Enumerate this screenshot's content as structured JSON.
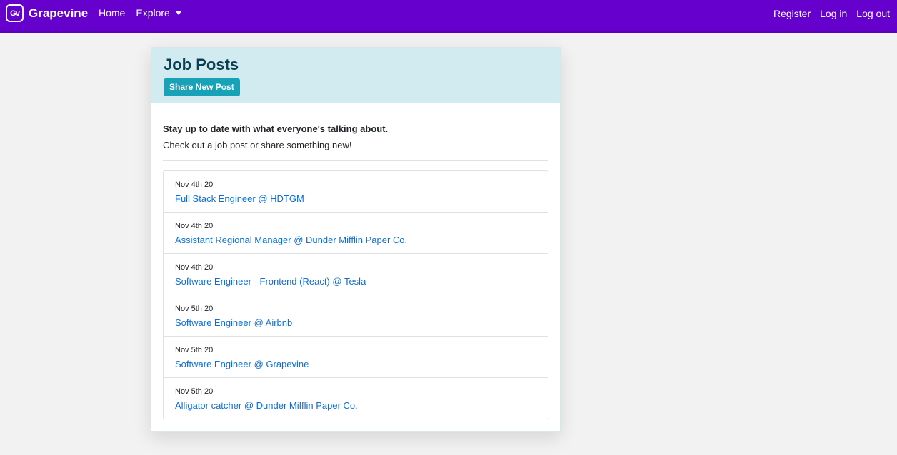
{
  "navbar": {
    "logo_text": "Gv",
    "brand": "Grapevine",
    "left_links": [
      {
        "label": "Home"
      },
      {
        "label": "Explore",
        "dropdown": true
      }
    ],
    "right_links": [
      {
        "label": "Register"
      },
      {
        "label": "Log in"
      },
      {
        "label": "Log out"
      }
    ]
  },
  "page": {
    "title": "Job Posts",
    "share_button": "Share New Post",
    "lead": "Stay up to date with what everyone's talking about.",
    "sub": "Check out a job post or share something new!"
  },
  "posts": [
    {
      "date": "Nov 4th 20",
      "title": "Full Stack Engineer @ HDTGM"
    },
    {
      "date": "Nov 4th 20",
      "title": "Assistant Regional Manager @ Dunder Mifflin Paper Co."
    },
    {
      "date": "Nov 4th 20",
      "title": "Software Engineer - Frontend (React) @ Tesla"
    },
    {
      "date": "Nov 5th 20",
      "title": "Software Engineer @ Airbnb"
    },
    {
      "date": "Nov 5th 20",
      "title": "Software Engineer @ Grapevine"
    },
    {
      "date": "Nov 5th 20",
      "title": "Alligator catcher @ Dunder Mifflin Paper Co."
    }
  ],
  "colors": {
    "navbar": "#6600cc",
    "header_bg": "#d1ebf1",
    "button": "#17a2b8",
    "link": "#0b6fd4"
  }
}
